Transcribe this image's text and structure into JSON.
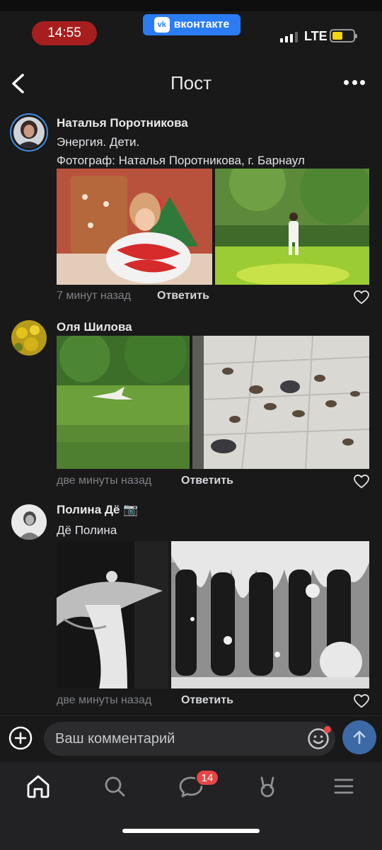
{
  "status": {
    "time": "14:55",
    "app_label": "вконтакте",
    "app_logo": "vk",
    "network": "LTE"
  },
  "header": {
    "title": "Пост"
  },
  "comments": [
    {
      "author": "Наталья Поротникова",
      "text_line1": "Энергия. Дети.",
      "text_line2": "Фотограф: Наталья Поротникова, г. Барнаул",
      "time": "7 минут назад",
      "reply": "Ответить"
    },
    {
      "author": "Оля Шилова",
      "time": "две минуты назад",
      "reply": "Ответить"
    },
    {
      "author": "Полина Дё 📷",
      "text_line1": "Дё Полина",
      "time": "две минуты назад",
      "reply": "Ответить"
    }
  ],
  "compose": {
    "placeholder": "Ваш комментарий"
  },
  "tabs": {
    "messages_badge": "14"
  },
  "colors": {
    "accent": "#2a7cf3",
    "badge": "#e64646",
    "background": "#19191a"
  }
}
